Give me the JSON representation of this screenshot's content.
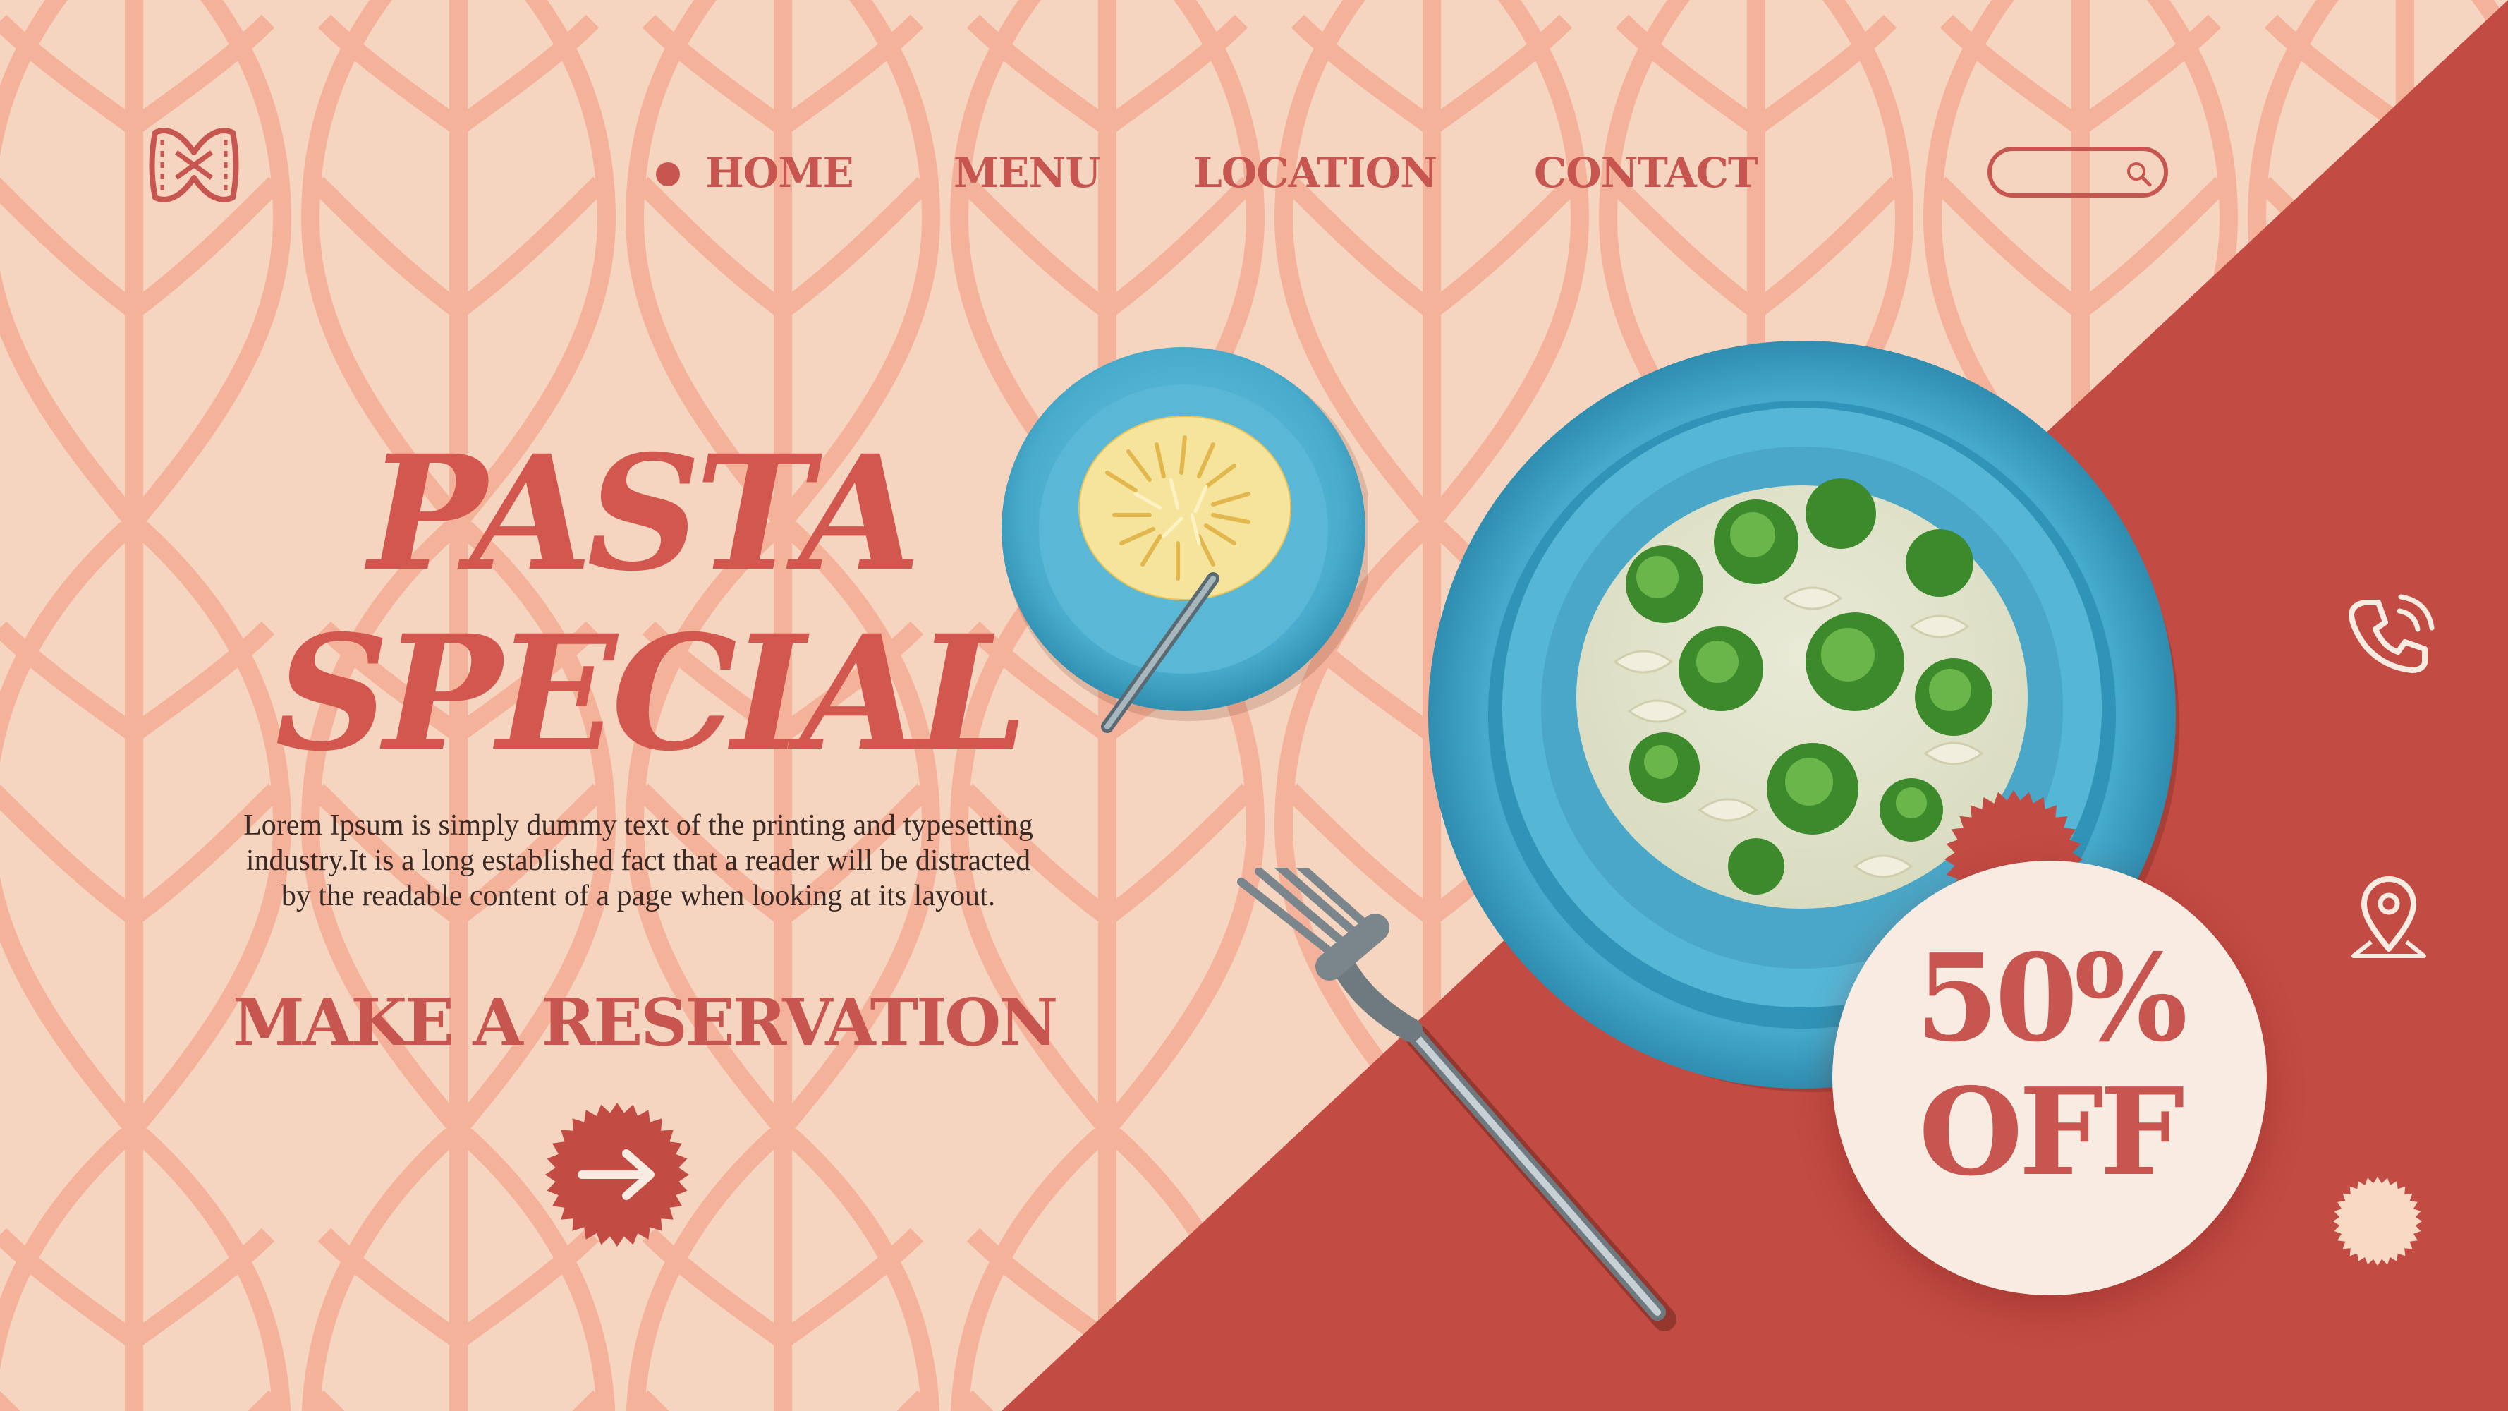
{
  "nav": {
    "home": "HOME",
    "menu": "MENU",
    "location": "LOCATION",
    "contact": "CONTACT"
  },
  "search": {
    "placeholder": ""
  },
  "hero": {
    "title_line1": "PASTA",
    "title_line2": "SPECIAL",
    "body": "Lorem Ipsum is simply dummy text of the printing and typesetting industry.It is a long established fact that a reader will be distracted by the readable content of a page when looking at its layout.",
    "cta": "MAKE A RESERVATION"
  },
  "promo": {
    "line1": "50%",
    "line2": "OFF"
  },
  "icons": {
    "logo": "farfalle-logo-icon",
    "search": "search-icon",
    "arrow": "arrow-right-icon",
    "phone": "phone-icon",
    "location": "location-pin-icon",
    "badge": "starburst-badge-icon"
  },
  "colors": {
    "accent": "#c85650",
    "background": "#f6d5c0",
    "pattern": "#f5b29a",
    "panel": "#c24b44",
    "bowl": "#4fb1d1"
  }
}
